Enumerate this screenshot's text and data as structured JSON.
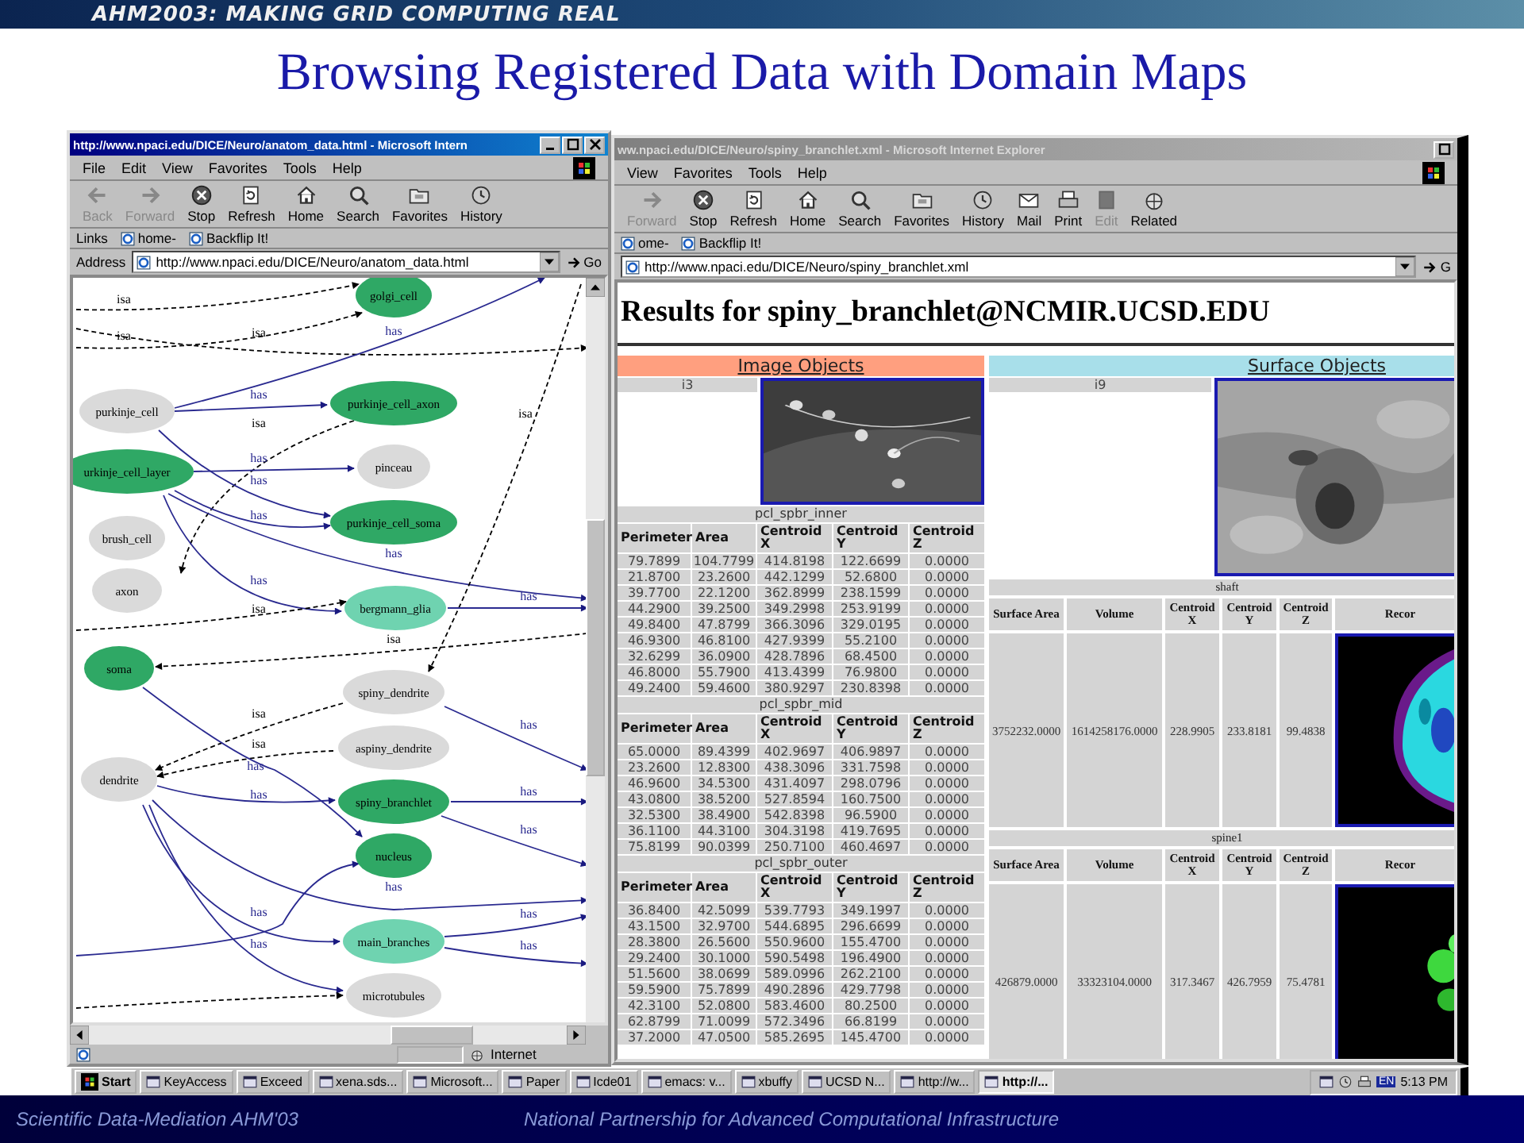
{
  "banner": {
    "title": "AHM2003: MAKING GRID COMPUTING REAL"
  },
  "slide_title": "Browsing Registered Data with Domain Maps",
  "left_window": {
    "title": "http://www.npaci.edu/DICE/Neuro/anatom_data.html - Microsoft Intern",
    "menu": [
      "File",
      "Edit",
      "View",
      "Favorites",
      "Tools",
      "Help"
    ],
    "toolbar": [
      {
        "label": "Back",
        "disabled": true
      },
      {
        "label": "Forward",
        "disabled": true
      },
      {
        "label": "Stop",
        "disabled": false
      },
      {
        "label": "Refresh",
        "disabled": false
      },
      {
        "label": "Home",
        "disabled": false
      },
      {
        "label": "Search",
        "disabled": false
      },
      {
        "label": "Favorites",
        "disabled": false
      },
      {
        "label": "History",
        "disabled": false
      }
    ],
    "links": {
      "label": "Links",
      "items": [
        "home-",
        "Backflip It!"
      ]
    },
    "address": {
      "label": "Address",
      "value": "http://www.npaci.edu/DICE/Neuro/anatom_data.html",
      "go": "Go"
    },
    "graph": {
      "nodes": [
        {
          "label": "golgi_cell",
          "color": "#2fa865"
        },
        {
          "label": "purkinje_cell_axon",
          "color": "#2fa865"
        },
        {
          "label": "purkinje_cell",
          "color": "#dadada"
        },
        {
          "label": "pinceau",
          "color": "#dadada"
        },
        {
          "label": "urkinje_cell_layer",
          "color": "#2fa865"
        },
        {
          "label": "purkinje_cell_soma",
          "color": "#2fa865"
        },
        {
          "label": "brush_cell",
          "color": "#dadada"
        },
        {
          "label": "axon",
          "color": "#dadada"
        },
        {
          "label": "bergmann_glia",
          "color": "#6fd3b0"
        },
        {
          "label": "soma",
          "color": "#2fa865"
        },
        {
          "label": "spiny_dendrite",
          "color": "#dadada"
        },
        {
          "label": "aspiny_dendrite",
          "color": "#dadada"
        },
        {
          "label": "dendrite",
          "color": "#dadada"
        },
        {
          "label": "spiny_branchlet",
          "color": "#2fa865"
        },
        {
          "label": "nucleus",
          "color": "#2fa865"
        },
        {
          "label": "main_branches",
          "color": "#6fd3b0"
        },
        {
          "label": "microtubules",
          "color": "#dadada"
        }
      ],
      "edges": [
        {
          "kind": "isa",
          "label": "isa"
        },
        {
          "kind": "isa",
          "label": "isa"
        },
        {
          "kind": "isa",
          "label": "isa"
        },
        {
          "kind": "has",
          "label": "has"
        },
        {
          "kind": "has",
          "label": "has"
        },
        {
          "kind": "isa",
          "label": "isa"
        },
        {
          "kind": "has",
          "label": "has"
        },
        {
          "kind": "has",
          "label": "has"
        },
        {
          "kind": "has",
          "label": "has"
        },
        {
          "kind": "has",
          "label": "has"
        },
        {
          "kind": "has",
          "label": "has"
        },
        {
          "kind": "isa",
          "label": "isa"
        },
        {
          "kind": "has",
          "label": "has"
        },
        {
          "kind": "isa",
          "label": "isa"
        },
        {
          "kind": "isa",
          "label": "isa"
        },
        {
          "kind": "isa",
          "label": "isa"
        },
        {
          "kind": "isa",
          "label": "isa"
        },
        {
          "kind": "has",
          "label": "has"
        },
        {
          "kind": "has",
          "label": "has"
        },
        {
          "kind": "has",
          "label": "has"
        },
        {
          "kind": "has",
          "label": "has"
        },
        {
          "kind": "has",
          "label": "has"
        },
        {
          "kind": "has",
          "label": "has"
        },
        {
          "kind": "has",
          "label": "has"
        },
        {
          "kind": "has",
          "label": "has"
        },
        {
          "kind": "has",
          "label": "has"
        },
        {
          "kind": "has",
          "label": "has"
        },
        {
          "kind": "has"
        },
        {
          "kind": "isa"
        }
      ]
    },
    "status": "Internet"
  },
  "right_window": {
    "title": "ww.npaci.edu/DICE/Neuro/spiny_branchlet.xml - Microsoft Internet Explorer",
    "menu": [
      "View",
      "Favorites",
      "Tools",
      "Help"
    ],
    "toolbar": [
      {
        "label": "Forward",
        "disabled": true
      },
      {
        "label": "Stop",
        "disabled": false
      },
      {
        "label": "Refresh",
        "disabled": false
      },
      {
        "label": "Home",
        "disabled": false
      },
      {
        "label": "Search",
        "disabled": false
      },
      {
        "label": "Favorites",
        "disabled": false
      },
      {
        "label": "History",
        "disabled": false
      },
      {
        "label": "Mail",
        "disabled": false
      },
      {
        "label": "Print",
        "disabled": false
      },
      {
        "label": "Edit",
        "disabled": true
      },
      {
        "label": "Related",
        "disabled": false
      }
    ],
    "links": [
      "ome-",
      "Backflip It!"
    ],
    "address": {
      "value": "http://www.npaci.edu/DICE/Neuro/spiny_branchlet.xml",
      "go": "G"
    },
    "page": {
      "heading": "Results for spiny_branchlet@NCMIR.UCSD.EDU",
      "image_objects": {
        "title": "Image Objects",
        "image_label": "i3",
        "groups": [
          {
            "name": "pcl_spbr_inner",
            "columns": [
              "Perimeter",
              "Area",
              "Centroid X",
              "Centroid Y",
              "Centroid Z"
            ],
            "rows": [
              [
                "79.7899",
                "104.7799",
                "414.8198",
                "122.6699",
                "0.0000"
              ],
              [
                "21.8700",
                "23.2600",
                "442.1299",
                "52.6800",
                "0.0000"
              ],
              [
                "39.7700",
                "22.1200",
                "362.8999",
                "238.1599",
                "0.0000"
              ],
              [
                "44.2900",
                "39.2500",
                "349.2998",
                "253.9199",
                "0.0000"
              ],
              [
                "49.8400",
                "47.8799",
                "366.3096",
                "329.0195",
                "0.0000"
              ],
              [
                "46.9300",
                "46.8100",
                "427.9399",
                "55.2100",
                "0.0000"
              ],
              [
                "32.6299",
                "36.0900",
                "428.7896",
                "68.4500",
                "0.0000"
              ],
              [
                "46.8000",
                "55.7900",
                "413.4399",
                "76.9800",
                "0.0000"
              ],
              [
                "49.2400",
                "59.4600",
                "380.9297",
                "230.8398",
                "0.0000"
              ]
            ]
          },
          {
            "name": "pcl_spbr_mid",
            "columns": [
              "Perimeter",
              "Area",
              "Centroid X",
              "Centroid Y",
              "Centroid Z"
            ],
            "rows": [
              [
                "65.0000",
                "89.4399",
                "402.9697",
                "406.9897",
                "0.0000"
              ],
              [
                "23.2600",
                "12.8300",
                "438.3096",
                "331.7598",
                "0.0000"
              ],
              [
                "46.9600",
                "34.5300",
                "431.4097",
                "298.0796",
                "0.0000"
              ],
              [
                "43.0800",
                "38.5200",
                "527.8594",
                "160.7500",
                "0.0000"
              ],
              [
                "32.5300",
                "38.4900",
                "542.8398",
                "96.5900",
                "0.0000"
              ],
              [
                "36.1100",
                "44.3100",
                "304.3198",
                "419.7695",
                "0.0000"
              ],
              [
                "75.8199",
                "90.0399",
                "250.7100",
                "460.4697",
                "0.0000"
              ]
            ]
          },
          {
            "name": "pcl_spbr_outer",
            "columns": [
              "Perimeter",
              "Area",
              "Centroid X",
              "Centroid Y",
              "Centroid Z"
            ],
            "rows": [
              [
                "36.8400",
                "42.5099",
                "539.7793",
                "349.1997",
                "0.0000"
              ],
              [
                "43.1500",
                "32.9700",
                "544.6895",
                "296.6699",
                "0.0000"
              ],
              [
                "28.3800",
                "26.5600",
                "550.9600",
                "155.4700",
                "0.0000"
              ],
              [
                "29.2400",
                "30.1000",
                "590.5498",
                "196.4900",
                "0.0000"
              ],
              [
                "51.5600",
                "38.0699",
                "589.0996",
                "262.2100",
                "0.0000"
              ],
              [
                "59.5900",
                "75.7899",
                "490.2896",
                "429.7798",
                "0.0000"
              ],
              [
                "42.3100",
                "52.0800",
                "583.4600",
                "80.2500",
                "0.0000"
              ],
              [
                "62.8799",
                "71.0099",
                "572.3496",
                "66.8199",
                "0.0000"
              ],
              [
                "37.2000",
                "47.0500",
                "585.2695",
                "145.4700",
                "0.0000"
              ]
            ]
          }
        ]
      },
      "surface_objects": {
        "title": "Surface Objects",
        "image_label": "i9",
        "groups": [
          {
            "name": "shaft",
            "columns": [
              "Surface Area",
              "Volume",
              "Centroid X",
              "Centroid Y",
              "Centroid Z",
              "Recor"
            ],
            "values": [
              "3752232.0000",
              "1614258176.0000",
              "228.9905",
              "233.8181",
              "99.4838"
            ]
          },
          {
            "name": "spine1",
            "columns": [
              "Surface Area",
              "Volume",
              "Centroid X",
              "Centroid Y",
              "Centroid Z",
              "Recor"
            ],
            "values": [
              "426879.0000",
              "33323104.0000",
              "317.3467",
              "426.7959",
              "75.4781"
            ]
          }
        ]
      }
    }
  },
  "taskbar": {
    "start": "Start",
    "tasks": [
      {
        "label": "KeyAccess",
        "selected": false
      },
      {
        "label": "Exceed",
        "selected": false
      },
      {
        "label": "xena.sds...",
        "selected": false
      },
      {
        "label": "Microsoft...",
        "selected": false
      },
      {
        "label": "Paper",
        "selected": false
      },
      {
        "label": "Icde01",
        "selected": false
      },
      {
        "label": "emacs: v...",
        "selected": false
      },
      {
        "label": "xbuffy",
        "selected": false
      },
      {
        "label": "UCSD N...",
        "selected": false
      },
      {
        "label": "http://w...",
        "selected": false
      },
      {
        "label": "http://...",
        "selected": true
      }
    ],
    "lang": "EN",
    "clock": "5:13 PM"
  },
  "footer": {
    "left": "Scientific Data-Mediation AHM'03",
    "right": "National Partnership for Advanced Computational Infrastructure"
  }
}
